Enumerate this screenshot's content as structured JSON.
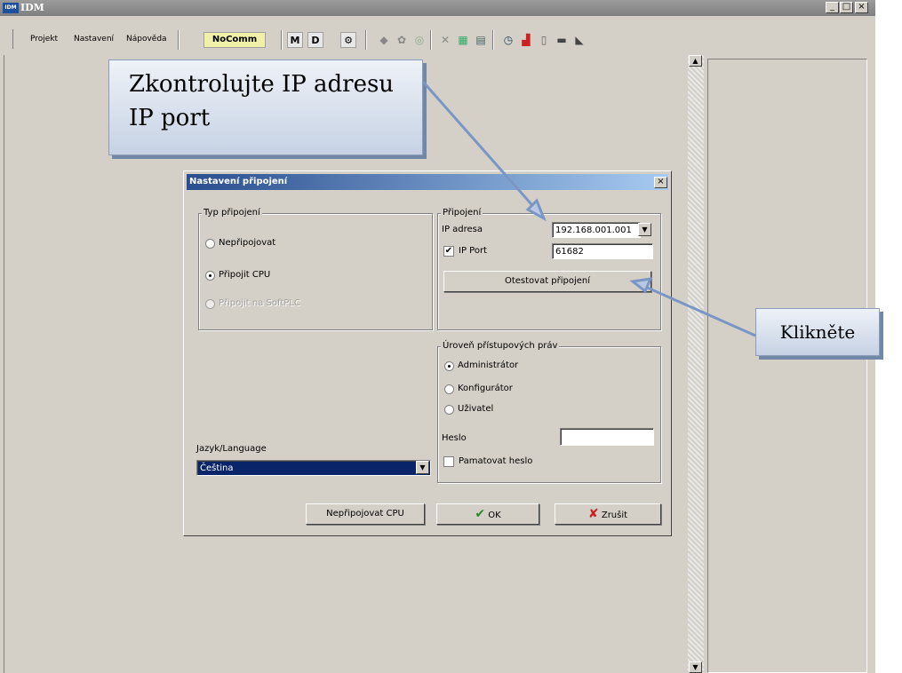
{
  "window": {
    "logo_text": "IDM",
    "title": "IDM",
    "controls": {
      "minimize": "_",
      "maximize": "□",
      "close": "×"
    }
  },
  "menu": {
    "project": "Projekt",
    "settings": "Nastavení",
    "help": "Nápověda"
  },
  "toolbar": {
    "status": "NoComm",
    "m_label": "M",
    "d_label": "D"
  },
  "callouts": {
    "top_line1": "Zkontrolujte IP adresu",
    "top_line2": "IP port",
    "right": "Klikněte"
  },
  "dialog": {
    "title": "Nastavení připojení",
    "close": "×",
    "conn_type": {
      "label": "Typ připojení",
      "options": [
        "Nepřipojovat",
        "Připojit CPU",
        "Připojit na SoftPLC"
      ],
      "selected": "Připojit CPU",
      "disabled": "Připojit na SoftPLC"
    },
    "connection": {
      "label": "Připojení",
      "ip_label": "IP adresa",
      "ip_value": "192.168.001.001",
      "port_label": "IP Port",
      "port_checked": true,
      "port_value": "61682",
      "test_button": "Otestovat připojení"
    },
    "access": {
      "label": "Úroveň přístupových práv",
      "options": [
        "Administrátor",
        "Konfigurátor",
        "Uživatel"
      ],
      "selected": "Administrátor",
      "password_label": "Heslo",
      "password_value": "",
      "remember_label": "Pamatovat heslo",
      "remember_checked": false
    },
    "language": {
      "label": "Jazyk/Language",
      "value": "Čeština"
    },
    "buttons": {
      "no_connect": "Nepřipojovat CPU",
      "ok": "OK",
      "cancel": "Zrušit"
    }
  },
  "colors": {
    "face": "#d4d0c8",
    "title_start": "#2a4e8e",
    "title_end": "#a6caf0",
    "callout": "#c6d2e4",
    "arrow": "#7a96c4"
  },
  "icons": [
    "tool-icon",
    "gear-icon",
    "settings-icon",
    "wrench-icon",
    "chart-icon",
    "table-icon",
    "timer-icon",
    "color-icon",
    "document-icon",
    "list-icon",
    "pointer-icon"
  ]
}
